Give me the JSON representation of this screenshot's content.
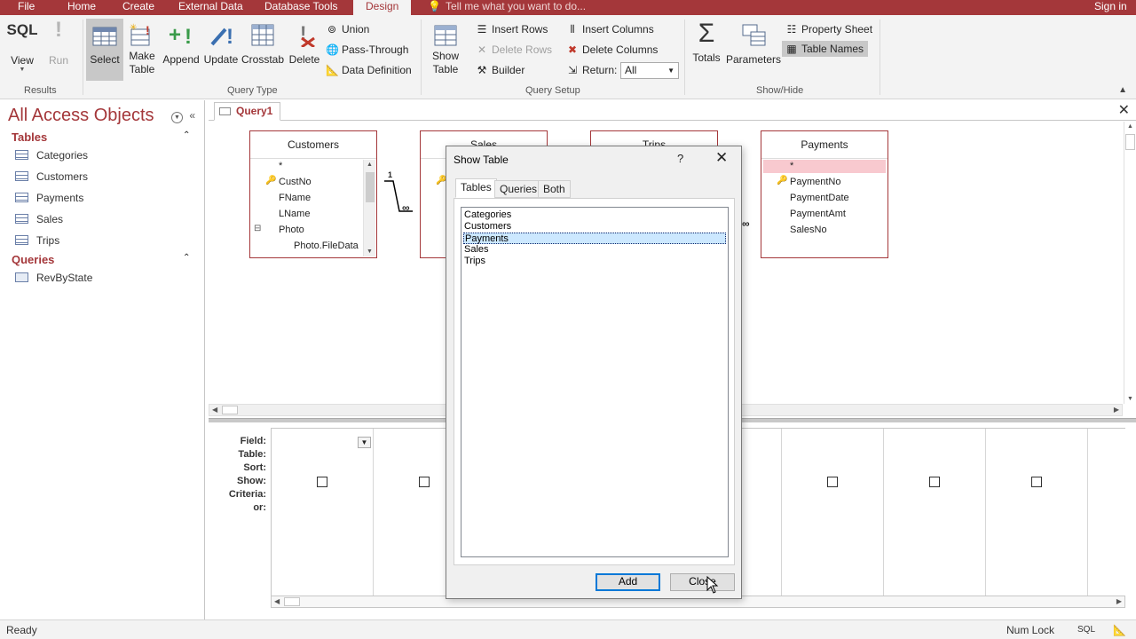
{
  "menubar": {
    "tabs": [
      "File",
      "Home",
      "Create",
      "External Data",
      "Database Tools",
      "Design"
    ],
    "active_tab": "Design",
    "tell_me": "Tell me what you want to do...",
    "sign_in": "Sign in",
    "accent_color": "#a4373a"
  },
  "ribbon": {
    "results": {
      "group_label": "Results",
      "view": "View",
      "view_icon_text": "SQL",
      "run": "Run"
    },
    "query_type": {
      "group_label": "Query Type",
      "select": "Select",
      "make_table_1": "Make",
      "make_table_2": "Table",
      "append": "Append",
      "update": "Update",
      "crosstab": "Crosstab",
      "delete": "Delete",
      "union": "Union",
      "pass_through": "Pass-Through",
      "data_definition": "Data Definition"
    },
    "query_setup": {
      "group_label": "Query Setup",
      "show_table_1": "Show",
      "show_table_2": "Table",
      "insert_rows": "Insert Rows",
      "delete_rows": "Delete Rows",
      "builder": "Builder",
      "insert_columns": "Insert Columns",
      "delete_columns": "Delete Columns",
      "return_label": "Return:",
      "return_value": "All"
    },
    "show_hide": {
      "group_label": "Show/Hide",
      "totals": "Totals",
      "parameters": "Parameters",
      "property_sheet": "Property Sheet",
      "table_names": "Table Names"
    }
  },
  "nav": {
    "title": "All Access Objects",
    "tables_header": "Tables",
    "tables": [
      "Categories",
      "Customers",
      "Payments",
      "Sales",
      "Trips"
    ],
    "queries_header": "Queries",
    "queries": [
      "RevByState"
    ]
  },
  "document": {
    "tab": "Query1"
  },
  "design": {
    "customers": {
      "title": "Customers",
      "fields": [
        "*",
        "CustNo",
        "FName",
        "LName",
        "Photo",
        "Photo.FileData"
      ]
    },
    "sales": {
      "title": "Sales"
    },
    "trips": {
      "title": "Trips"
    },
    "payments": {
      "title": "Payments",
      "fields": [
        "*",
        "PaymentNo",
        "PaymentDate",
        "PaymentAmt",
        "SalesNo"
      ]
    },
    "relation_one": "1",
    "relation_many": "∞"
  },
  "grid": {
    "row_labels": [
      "Field:",
      "Table:",
      "Sort:",
      "Show:",
      "Criteria:",
      "or:"
    ]
  },
  "status": {
    "ready": "Ready",
    "num_lock": "Num Lock",
    "sql": "SQL"
  },
  "dialog": {
    "title": "Show Table",
    "help": "?",
    "close_x": "✕",
    "tabs": [
      "Tables",
      "Queries",
      "Both"
    ],
    "active_tab": "Tables",
    "items": [
      "Categories",
      "Customers",
      "Payments",
      "Sales",
      "Trips"
    ],
    "selected": "Payments",
    "add": "Add",
    "close": "Close"
  }
}
